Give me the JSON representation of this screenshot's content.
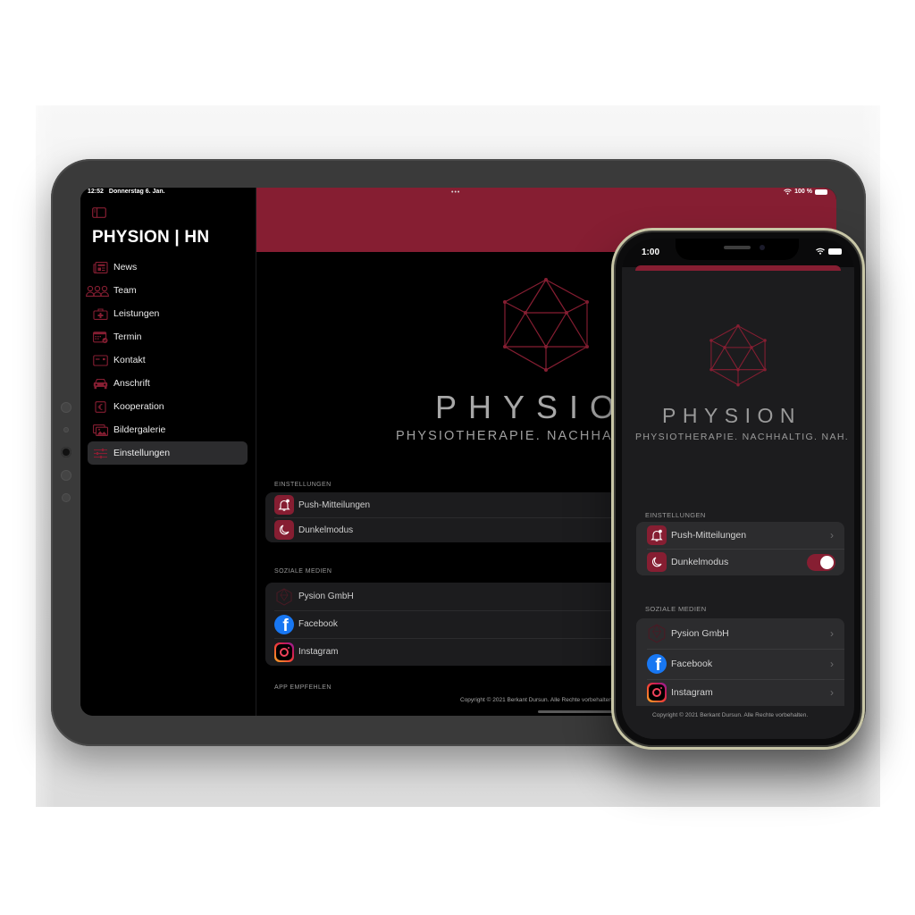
{
  "colors": {
    "accent": "#861e32",
    "background": "#000000",
    "group_background_tablet": "#1c1c1e",
    "group_background_phone": "#2c2c2e",
    "facebook": "#1877f2"
  },
  "tablet": {
    "status_bar": {
      "time": "12:52",
      "date": "Donnerstag 6. Jan.",
      "multitask_dots": "•••",
      "battery": "100 %"
    },
    "sidebar": {
      "app_title": "PHYSION | HN",
      "items": [
        {
          "label": "News",
          "icon": "newspaper-icon"
        },
        {
          "label": "Team",
          "icon": "people-icon"
        },
        {
          "label": "Leistungen",
          "icon": "medical-kit-icon"
        },
        {
          "label": "Termin",
          "icon": "calendar-icon"
        },
        {
          "label": "Kontakt",
          "icon": "contact-card-icon"
        },
        {
          "label": "Anschrift",
          "icon": "car-icon"
        },
        {
          "label": "Kooperation",
          "icon": "euro-icon"
        },
        {
          "label": "Bildergalerie",
          "icon": "photos-icon"
        },
        {
          "label": "Einstellungen",
          "icon": "sliders-icon",
          "active": true
        }
      ]
    },
    "main": {
      "brand": "PHYSION",
      "tagline": "PHYSIOTHERAPIE. NACHHALTIG. NAH.",
      "sections": [
        {
          "title": "EINSTELLUNGEN",
          "rows": [
            {
              "label": "Push-Mitteilungen",
              "icon": "bell-icon"
            },
            {
              "label": "Dunkelmodus",
              "icon": "moon-icon"
            }
          ]
        },
        {
          "title": "SOZIALE MEDIEN",
          "rows": [
            {
              "label": "Pysion GmbH",
              "icon": "physion-logo-icon"
            },
            {
              "label": "Facebook",
              "icon": "facebook-icon"
            },
            {
              "label": "Instagram",
              "icon": "instagram-icon"
            }
          ]
        },
        {
          "title": "APP EMPFEHLEN",
          "rows": []
        }
      ],
      "copyright": "Copyright © 2021 Berkant Dursun. Alle Rechte vorbehalten."
    }
  },
  "phone": {
    "status_bar": {
      "time": "1:00"
    },
    "brand": "PHYSION",
    "tagline": "PHYSIOTHERAPIE. NACHHALTIG. NAH.",
    "sections": [
      {
        "title": "EINSTELLUNGEN",
        "rows": [
          {
            "label": "Push-Mitteilungen",
            "icon": "bell-icon",
            "accessory": "chevron"
          },
          {
            "label": "Dunkelmodus",
            "icon": "moon-icon",
            "accessory": "toggle",
            "toggle_on": true
          }
        ]
      },
      {
        "title": "SOZIALE MEDIEN",
        "rows": [
          {
            "label": "Pysion GmbH",
            "icon": "physion-logo-icon",
            "accessory": "chevron"
          },
          {
            "label": "Facebook",
            "icon": "facebook-icon",
            "accessory": "chevron"
          },
          {
            "label": "Instagram",
            "icon": "instagram-icon",
            "accessory": "chevron"
          }
        ]
      }
    ],
    "chevron_glyph": "›",
    "facebook_glyph": "f",
    "copyright": "Copyright © 2021 Berkant Dursun. Alle Rechte vorbehalten."
  }
}
